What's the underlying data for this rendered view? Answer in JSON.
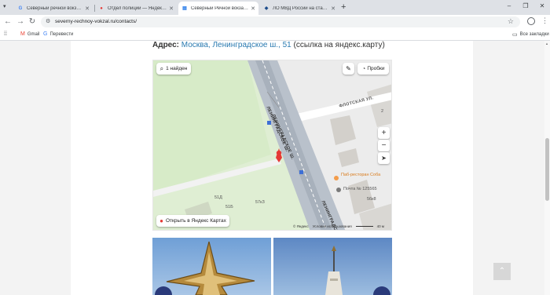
{
  "browser": {
    "tabs": [
      {
        "title": "Северный речной вокзал де…",
        "icon": "google-icon"
      },
      {
        "title": "Отдел полиции — Яндекс Карт",
        "icon": "yandex-maps-pin-icon"
      },
      {
        "title": "Северный Речной вокзал тел…",
        "icon": "page-icon",
        "active": true
      },
      {
        "title": "ЛО МВД России на станции М…",
        "icon": "shield-icon"
      }
    ],
    "new_tab": "+",
    "url": "severny-rechnoy-vokzal.ru/contacts/",
    "bookmarks": [
      {
        "label": "Gmail",
        "icon": "gmail-icon"
      },
      {
        "label": "Перевести",
        "icon": "translate-icon"
      }
    ],
    "all_bookmarks": "Все закладки"
  },
  "page": {
    "address_label": "Адрес:",
    "address_link": "Москва, Ленинградское ш., 51",
    "address_note": "(ссылка на яндекс.карту)"
  },
  "map": {
    "search_result": "1 найден",
    "traffic": "Пробки",
    "zoom_in": "+",
    "zoom_out": "−",
    "open_in": "Открыть в Яндекс Картах",
    "streets": {
      "leningradskoe_1": "ЛЕНИНГРАДСКОЕ Ш.",
      "leningradskoe_2": "ЛЕНИНГРАДСКОЕ Ш.",
      "leningradskoe_3": "ЛЕНИНГРАДСКОЕ",
      "flotskaya": "ФЛОТСКАЯ УЛ."
    },
    "pois": {
      "cafe": "Паб-ресторан Соба",
      "post": "Почта № 125565"
    },
    "buildings": {
      "b1": "51Б",
      "b2": "51Д",
      "b3": "57кЗ",
      "b4": "2",
      "b5": "4",
      "b6": "56к8"
    },
    "footer": {
      "brand": "© Яндекс",
      "terms": "Условия использования",
      "scale": "40 м"
    }
  },
  "scroll_top": "⌃"
}
